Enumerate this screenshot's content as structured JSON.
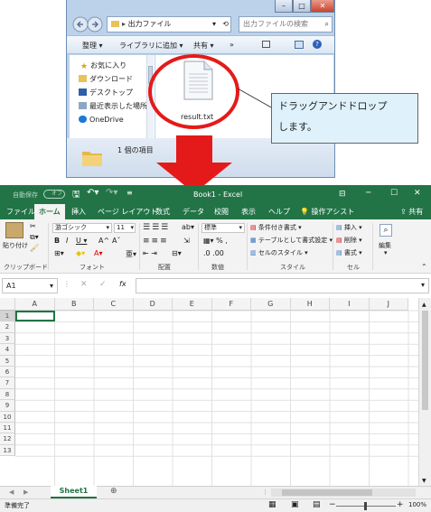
{
  "explorer": {
    "address_path": "出力ファイル",
    "search_placeholder": "出力ファイルの検索",
    "toolbar": {
      "organize": "整理",
      "add_to_library": "ライブラリに追加",
      "share": "共有",
      "more": "»"
    },
    "nav": [
      {
        "label": "お気に入り"
      },
      {
        "label": "ダウンロード"
      },
      {
        "label": "デスクトップ"
      },
      {
        "label": "最近表示した場所"
      },
      {
        "label": "OneDrive"
      }
    ],
    "file_name": "result.txt",
    "item_count": "1 個の項目"
  },
  "callout": {
    "line1": "ドラッグアンドドロップ",
    "line2": "します。"
  },
  "excel": {
    "autosave": "自動保存",
    "autosave_state": "オフ",
    "title": "Book1 - Excel",
    "tabs": [
      "ファイル",
      "ホーム",
      "挿入",
      "ページ レイアウト",
      "数式",
      "データ",
      "校閲",
      "表示",
      "ヘルプ"
    ],
    "tell_me": "操作アシスト",
    "share": "共有",
    "ribbon": {
      "paste": "貼り付け",
      "font_name": "游ゴシック",
      "font_size": "11",
      "number_format": "標準",
      "conditional_format": "条件付き書式",
      "format_as_table": "テーブルとして書式設定",
      "cell_styles": "セルのスタイル",
      "insert": "挿入",
      "delete": "削除",
      "format": "書式",
      "editing": "編集",
      "groups": [
        "クリップボード",
        "フォント",
        "配置",
        "数値",
        "スタイル",
        "セル"
      ]
    },
    "name_box": "A1",
    "columns": [
      "A",
      "B",
      "C",
      "D",
      "E",
      "F",
      "G",
      "H",
      "I",
      "J"
    ],
    "rows": [
      "1",
      "2",
      "3",
      "4",
      "5",
      "6",
      "7",
      "8",
      "9",
      "10",
      "11",
      "12",
      "13"
    ],
    "sheet_tab": "Sheet1",
    "status": "準備完了",
    "zoom": "100%"
  }
}
